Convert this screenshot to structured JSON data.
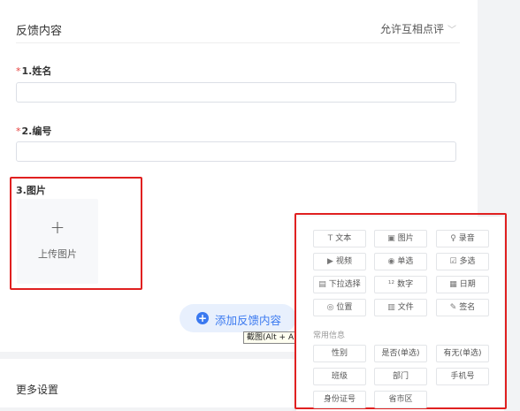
{
  "header": {
    "title": "反馈内容",
    "setting": "允许互相点评",
    "setting_chevron": "chevron-down-icon"
  },
  "fields": [
    {
      "required": true,
      "label": "1.姓名",
      "value": "",
      "placeholder": ""
    },
    {
      "required": true,
      "label": "2.编号",
      "value": "",
      "placeholder": ""
    },
    {
      "required": false,
      "label": "3.图片"
    }
  ],
  "upload": {
    "plus": "+",
    "label": "上传图片"
  },
  "add_button": {
    "icon": "+",
    "label": "添加反馈内容"
  },
  "tooltip": "截图(Alt + A)",
  "more_settings": "更多设置",
  "picker": {
    "basic": [
      {
        "icon": "T",
        "icon_name": "text-icon",
        "label": "文本"
      },
      {
        "icon": "▣",
        "icon_name": "image-icon",
        "label": "图片"
      },
      {
        "icon": "♀",
        "icon_name": "microphone-icon",
        "label": "录音"
      },
      {
        "icon": "▶",
        "icon_name": "video-icon",
        "label": "视频"
      },
      {
        "icon": "◉",
        "icon_name": "radio-icon",
        "label": "单选"
      },
      {
        "icon": "☑",
        "icon_name": "checkbox-icon",
        "label": "多选"
      },
      {
        "icon": "▤",
        "icon_name": "dropdown-icon",
        "label": "下拉选择"
      },
      {
        "icon": "¹²",
        "icon_name": "number-icon",
        "label": "数字"
      },
      {
        "icon": "▦",
        "icon_name": "calendar-icon",
        "label": "日期"
      },
      {
        "icon": "◎",
        "icon_name": "location-icon",
        "label": "位置"
      },
      {
        "icon": "▥",
        "icon_name": "file-icon",
        "label": "文件"
      },
      {
        "icon": "✎",
        "icon_name": "signature-icon",
        "label": "签名"
      }
    ],
    "common_title": "常用信息",
    "common": [
      {
        "label": "性别"
      },
      {
        "label": "是否(单选)"
      },
      {
        "label": "有无(单选)"
      },
      {
        "label": "班级"
      },
      {
        "label": "部门"
      },
      {
        "label": "手机号"
      },
      {
        "label": "身份证号"
      },
      {
        "label": "省市区"
      }
    ]
  },
  "colors": {
    "accent": "#3a79f0",
    "required": "#e64340",
    "highlight_box": "#e02020"
  }
}
